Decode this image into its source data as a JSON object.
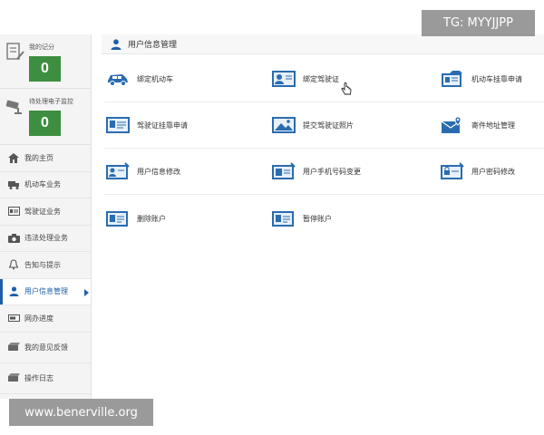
{
  "overlays": {
    "tg_label": "TG: MYYJJPP",
    "watermark": "www.benerville.org"
  },
  "sidebar": {
    "scores": [
      {
        "label": "我的记分",
        "value": "0",
        "icon": "document-pen-icon"
      },
      {
        "label": "待处理电子监控",
        "value": "0",
        "icon": "camera-icon"
      }
    ],
    "items": [
      {
        "label": "我的主页",
        "icon": "home-icon"
      },
      {
        "label": "机动车业务",
        "icon": "truck-icon"
      },
      {
        "label": "驾驶证业务",
        "icon": "id-card-icon"
      },
      {
        "label": "违法处理业务",
        "icon": "camera-icon"
      },
      {
        "label": "告知与提示",
        "icon": "bell-icon"
      },
      {
        "label": "用户信息管理",
        "icon": "user-icon",
        "active": true
      },
      {
        "label": "网办进度",
        "icon": "progress-icon"
      },
      {
        "label": "我的意见反馈",
        "icon": "feedback-icon"
      },
      {
        "label": "操作日志",
        "icon": "log-icon"
      }
    ]
  },
  "main": {
    "title": "用户信息管理",
    "tiles": [
      {
        "label": "绑定机动车",
        "icon": "car-icon"
      },
      {
        "label": "绑定驾驶证",
        "icon": "id-card-icon"
      },
      {
        "label": "机动车挂靠申请",
        "icon": "vehicle-doc-icon"
      },
      {
        "label": "驾驶证挂靠申请",
        "icon": "license-doc-icon"
      },
      {
        "label": "提交驾驶证照片",
        "icon": "photo-icon"
      },
      {
        "label": "寄件地址管理",
        "icon": "mail-location-icon"
      },
      {
        "label": "用户信息修改",
        "icon": "user-edit-icon"
      },
      {
        "label": "用户手机号码变更",
        "icon": "phone-edit-icon"
      },
      {
        "label": "用户密码修改",
        "icon": "password-edit-icon"
      },
      {
        "label": "删除账户",
        "icon": "delete-account-icon"
      },
      {
        "label": "暂停账户",
        "icon": "pause-account-icon"
      }
    ]
  },
  "colors": {
    "accent": "#1e5fa8",
    "score_green": "#3e8e41",
    "icon_blue": "#2b6cb0"
  }
}
